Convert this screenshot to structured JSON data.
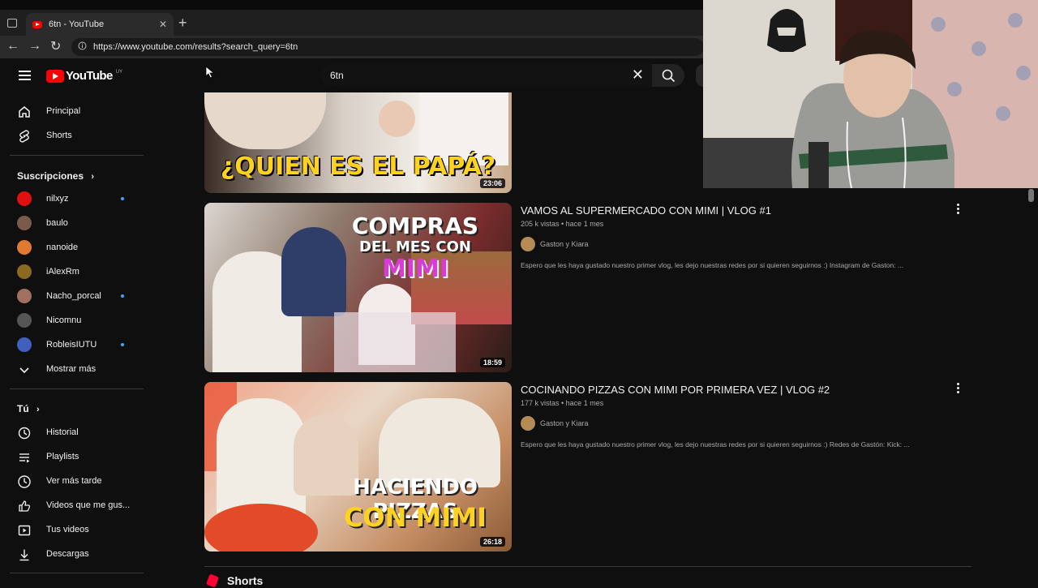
{
  "browser": {
    "tab_title": "6tn - YouTube",
    "url": "https://www.youtube.com/results?search_query=6tn"
  },
  "masthead": {
    "logo_text": "YouTube",
    "region": "UY",
    "search_value": "6tn"
  },
  "sidebar": {
    "main": [
      {
        "label": "Principal",
        "icon": "home-icon"
      },
      {
        "label": "Shorts",
        "icon": "shorts-icon"
      }
    ],
    "subscriptions_title": "Suscripciones",
    "subscriptions": [
      {
        "label": "nilxyz",
        "new": true,
        "color": "#e01010"
      },
      {
        "label": "baulo",
        "new": false,
        "color": "#7a5a4a"
      },
      {
        "label": "nanoide",
        "new": false,
        "color": "#e07a30"
      },
      {
        "label": "iAlexRm",
        "new": false,
        "color": "#8a6a20"
      },
      {
        "label": "Nacho_porcal",
        "new": true,
        "color": "#a07060"
      },
      {
        "label": "Nicomnu",
        "new": false,
        "color": "#555555"
      },
      {
        "label": "RobleisIUTU",
        "new": true,
        "color": "#4060c0"
      }
    ],
    "show_more": "Mostrar más",
    "you_title": "Tú",
    "you": [
      {
        "label": "Historial",
        "icon": "history-icon"
      },
      {
        "label": "Playlists",
        "icon": "playlists-icon"
      },
      {
        "label": "Ver más tarde",
        "icon": "watch-later-icon"
      },
      {
        "label": "Videos que me gus...",
        "icon": "liked-icon"
      },
      {
        "label": "Tus videos",
        "icon": "your-videos-icon"
      },
      {
        "label": "Descargas",
        "icon": "downloads-icon"
      }
    ]
  },
  "results": [
    {
      "thumb_text": "¿QUIEN ES EL PAPÁ?",
      "duration": "23:06"
    },
    {
      "title": "VAMOS AL SUPERMERCADO CON MIMI | VLOG #1",
      "meta": "205 k vistas • hace 1 mes",
      "channel": "Gaston y Kiara",
      "description": "Espero que les haya gustado nuestro primer vlog, les dejo nuestras redes por si quieren seguirnos :) Instagram de Gaston: ...",
      "thumb_text_1": "COMPRAS",
      "thumb_text_2": "DEL MES CON",
      "thumb_text_3": "MIMI",
      "duration": "18:59"
    },
    {
      "title": "COCINANDO PIZZAS CON MIMI POR PRIMERA VEZ | VLOG #2",
      "meta": "177 k vistas • hace 1 mes",
      "channel": "Gaston y Kiara",
      "description": "Espero que les haya gustado nuestro primer vlog, les dejo nuestras redes por si quieren seguirnos :) Redes de Gastón: Kick: ...",
      "thumb_text_1": "HACIENDO PIZZAS",
      "thumb_text_2": "CON MIMI",
      "duration": "26:18"
    }
  ],
  "shorts_title": "Shorts",
  "colors": {
    "background": "#0f0f0f",
    "brand_red": "#ff0000",
    "new_dot": "#3ea6ff",
    "thumb_yellow": "#ffd21f"
  }
}
